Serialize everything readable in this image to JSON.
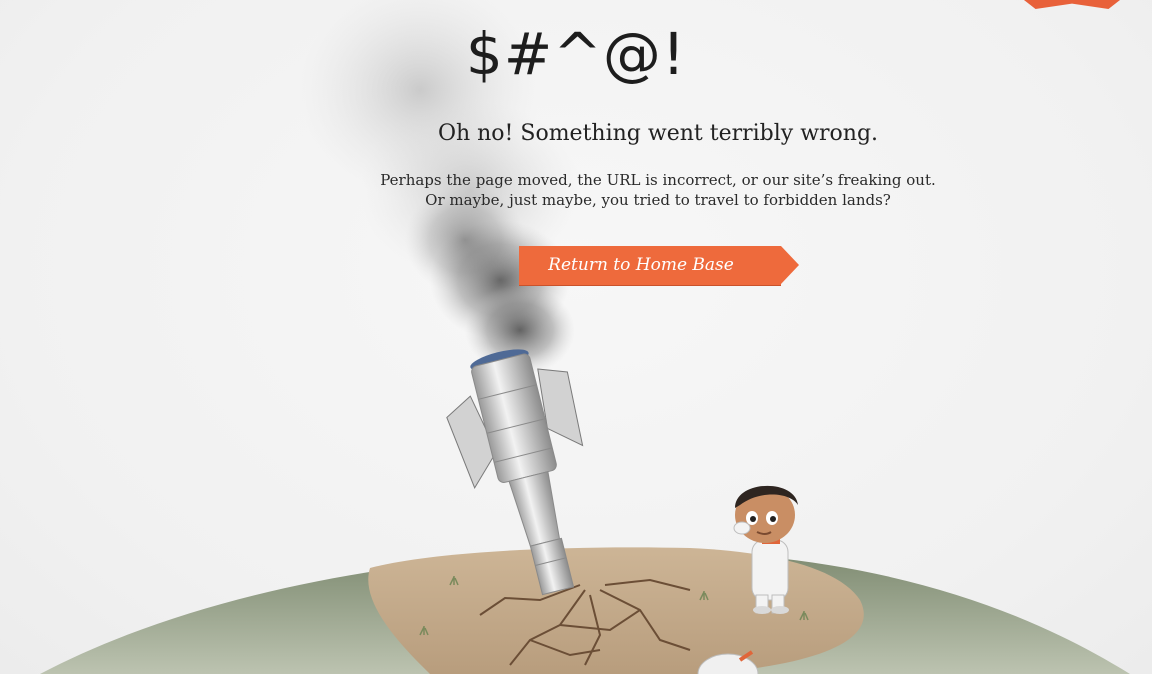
{
  "header": {
    "title": "$#^@!"
  },
  "error": {
    "headline": "Oh no! Something went terribly  wrong.",
    "message_line1": "Perhaps the page moved, the URL is incorrect, or our site’s freaking out.",
    "message_line2": "Or maybe, just maybe, you tried to travel to forbidden  lands?"
  },
  "actions": {
    "home_button_label": "Return to Home Base"
  },
  "colors": {
    "accent": "#ee6a3c",
    "ground": "#8a957c",
    "dirt": "#c9b193"
  },
  "illustration": {
    "icons": [
      "crashed-rocket-icon",
      "astronaut-boy-icon",
      "planet-ground-icon",
      "smoke-icon"
    ]
  }
}
